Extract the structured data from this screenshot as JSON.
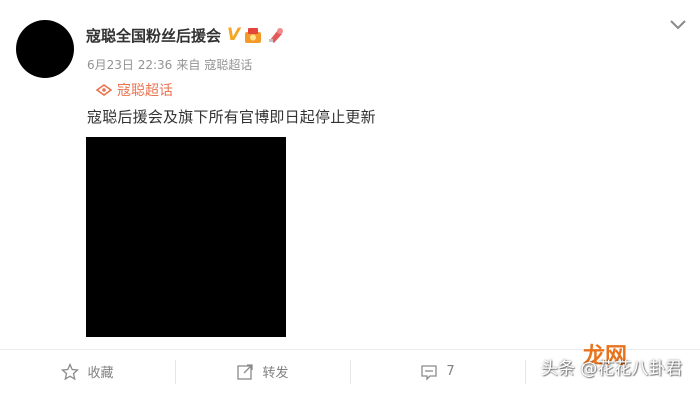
{
  "post": {
    "username": "寇聪全国粉丝后援会",
    "vip_badge": "V",
    "date": "6月23日 22:36",
    "source_prefix": "来自",
    "source": "寇聪超话",
    "supertopic": "寇聪超话",
    "text": "寇聪后援会及旗下所有官博即日起停止更新"
  },
  "actions": {
    "favorite_label": "收藏",
    "repost_label": "转发",
    "comment_count": "7"
  },
  "watermark": {
    "text": "头条 @花花八卦君",
    "brand": "龙网"
  },
  "colors": {
    "accent_orange": "#eb7350",
    "vip_gold": "#f5a623",
    "muted_text": "#939393",
    "action_text": "#808080"
  },
  "icons": [
    "vip-icon",
    "medal-icon",
    "fan-badge-icon",
    "supertopic-icon",
    "chevron-down-icon",
    "star-icon",
    "repost-icon",
    "comment-icon"
  ]
}
